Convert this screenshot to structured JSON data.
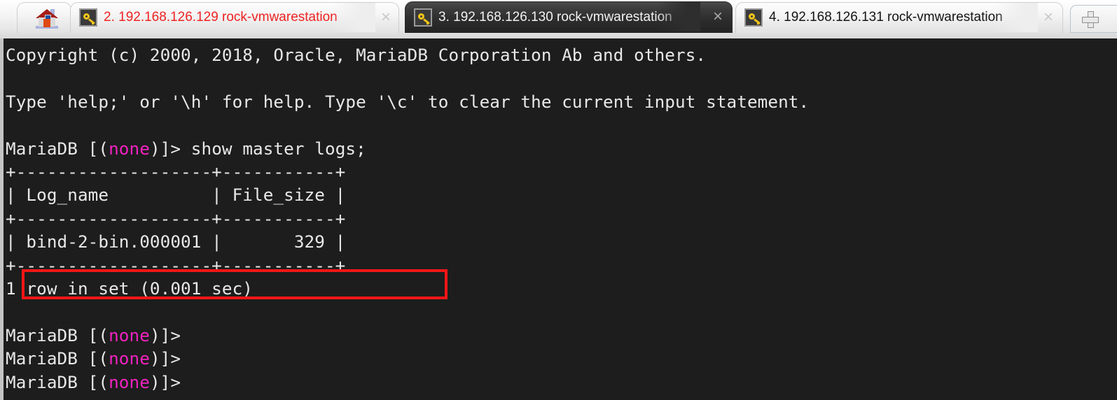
{
  "window": {
    "app": "ssh-terminal-tabbed-client",
    "background_color": "#1d1d1d",
    "tabbar_background": "#e6e6e6"
  },
  "tabbar": {
    "home_tab": {
      "icon": "home-icon",
      "label": ""
    },
    "new_tab_button": {
      "icon": "plus-icon",
      "label": ""
    },
    "close_glyph": "×",
    "tabs": [
      {
        "index": "2",
        "icon": "key-icon",
        "label": "2. 192.168.126.129 rock-vmwarestation",
        "active": false,
        "text_color": "#ee2222"
      },
      {
        "index": "3",
        "icon": "key-icon",
        "label": "3. 192.168.126.130 rock-vmwarestation",
        "active": true,
        "text_color": "#f2f2f2"
      },
      {
        "index": "4",
        "icon": "key-icon",
        "label": "4. 192.168.126.131 rock-vmwarestation",
        "active": false,
        "text_color": "#141414"
      }
    ]
  },
  "terminal": {
    "prompt_db_color": "#f222c0",
    "foreground": "#e8e8e8",
    "lines": [
      {
        "text": "Copyright (c) 2000, 2018, Oracle, MariaDB Corporation Ab and others."
      },
      {
        "text": ""
      },
      {
        "text": "Type 'help;' or '\\h' for help. Type '\\c' to clear the current input statement."
      },
      {
        "text": ""
      },
      {
        "prompt": true,
        "pre": "MariaDB [(",
        "db": "none",
        "post": ")]> ",
        "cmd": "show master logs;"
      },
      {
        "text": "+-------------------+-----------+"
      },
      {
        "text": "| Log_name          | File_size |"
      },
      {
        "text": "+-------------------+-----------+"
      },
      {
        "text": "| bind-2-bin.000001 |       329 |"
      },
      {
        "text": "+-------------------+-----------+"
      },
      {
        "text": "1 row in set (0.001 sec)"
      },
      {
        "text": ""
      },
      {
        "prompt": true,
        "pre": "MariaDB [(",
        "db": "none",
        "post": ")]> ",
        "cmd": ""
      },
      {
        "prompt": true,
        "pre": "MariaDB [(",
        "db": "none",
        "post": ")]> ",
        "cmd": ""
      },
      {
        "prompt": true,
        "pre": "MariaDB [(",
        "db": "none",
        "post": ")]> ",
        "cmd": ""
      }
    ],
    "query": "show master logs;",
    "result_table": {
      "columns": [
        "Log_name",
        "File_size"
      ],
      "rows": [
        [
          "bind-2-bin.000001",
          "329"
        ]
      ],
      "status": "1 row in set (0.001 sec)"
    },
    "highlight": {
      "color": "#f21616",
      "target_text": "| bind-2-bin.000001 |       329 |"
    }
  }
}
